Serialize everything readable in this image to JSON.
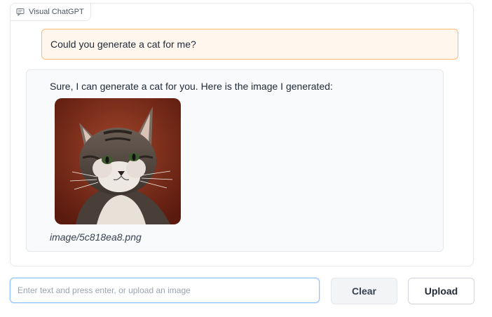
{
  "app": {
    "panel_label": "Visual ChatGPT"
  },
  "conversation": {
    "user_message": "Could you generate a cat for me?",
    "bot_message": "Sure, I can generate a cat for you. Here is the image I generated:",
    "bot_image_caption": "image/5c818ea8.png"
  },
  "composer": {
    "placeholder": "Enter text and press enter, or upload an image",
    "value": ""
  },
  "buttons": {
    "clear_label": "Clear",
    "upload_label": "Upload"
  },
  "colors": {
    "user_bubble_bg": "#fff7ed",
    "user_bubble_border": "#fdba74",
    "bot_bubble_bg": "#f9fafb",
    "input_focus_border": "#93c5fd"
  },
  "icons": {
    "panel_label_icon": "chat-icon"
  }
}
